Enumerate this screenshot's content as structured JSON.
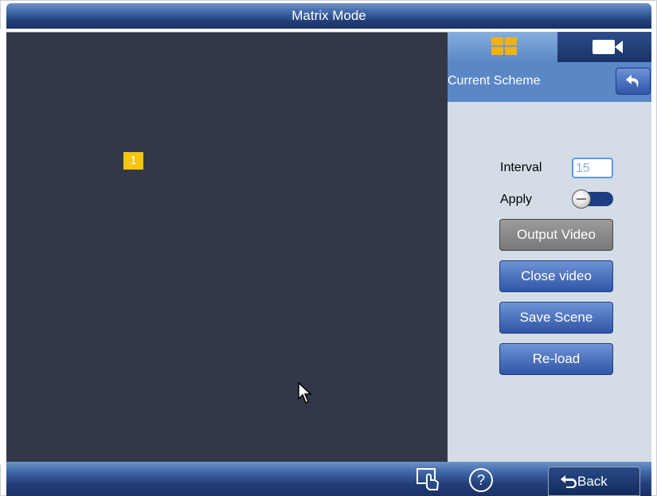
{
  "window": {
    "title": "Matrix Mode"
  },
  "video": {
    "window_number": "1"
  },
  "panel": {
    "tabs": [
      {
        "name": "layout-tab",
        "icon": "grid-icon",
        "active": true
      },
      {
        "name": "camera-tab",
        "icon": "camera-icon",
        "active": false
      }
    ],
    "scheme_label": "Current Scheme",
    "interval_label": "Interval",
    "interval_value": "15",
    "apply_label": "Apply",
    "apply_on": false,
    "buttons": {
      "output_video": "Output Video",
      "close_video": "Close video",
      "save_scene": "Save Scene",
      "reload": "Re-load"
    }
  },
  "bottom": {
    "back_label": "Back"
  },
  "colors": {
    "accent": "#f6c40c",
    "panel_bg": "#d4dde6",
    "video_bg": "#323848",
    "button_blue": "#2f55a6"
  }
}
